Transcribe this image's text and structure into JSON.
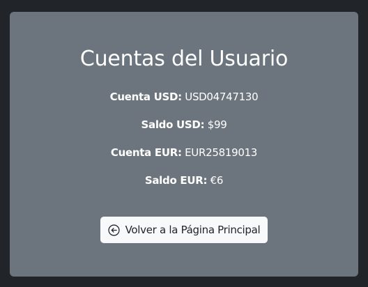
{
  "page": {
    "title": "Cuentas del Usuario"
  },
  "accounts": {
    "usd_account_label": "Cuenta USD:",
    "usd_account_value": "USD04747130",
    "usd_balance_label": "Saldo USD:",
    "usd_balance_value": "$99",
    "eur_account_label": "Cuenta EUR:",
    "eur_account_value": "EUR25819013",
    "eur_balance_label": "Saldo EUR:",
    "eur_balance_value": "€6"
  },
  "actions": {
    "back_label": "Volver a la Página Principal",
    "back_icon": "arrow-left-circle-icon"
  },
  "colors": {
    "page_background": "#212529",
    "card_background": "#6c757d",
    "button_background": "#f8f9fa",
    "button_text": "#212529"
  }
}
